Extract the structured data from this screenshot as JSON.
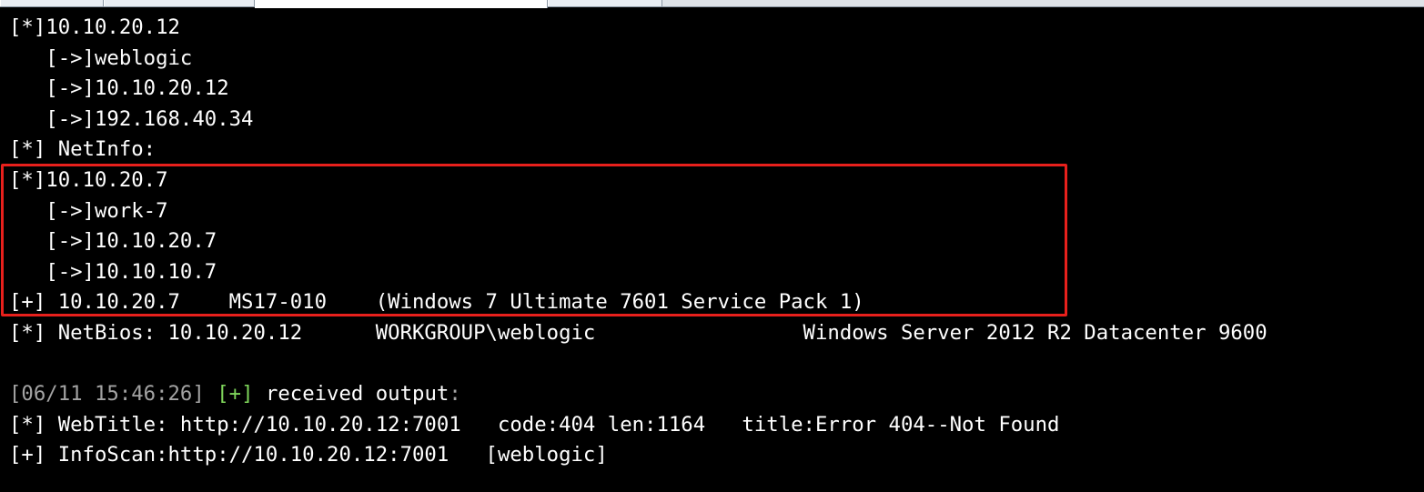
{
  "window": {
    "tabs": [
      {
        "label": "",
        "active": false
      },
      {
        "label": "",
        "active": true
      },
      {
        "label": "",
        "active": false
      }
    ]
  },
  "colors": {
    "background": "#000000",
    "text": "#ffffff",
    "timestamp": "#a3a3a3",
    "success_tag": "#7fd65b",
    "highlight_border": "#e8201c"
  },
  "console": {
    "lines": [
      "[*]10.10.20.12",
      "   [->]weblogic",
      "   [->]10.10.20.12",
      "   [->]192.168.40.34",
      "[*] NetInfo:",
      "[*]10.10.20.7",
      "   [->]work-7",
      "   [->]10.10.20.7",
      "   [->]10.10.10.7",
      "[+] 10.10.20.7    MS17-010    (Windows 7 Ultimate 7601 Service Pack 1)",
      "[*] NetBios: 10.10.20.12      WORKGROUP\\weblogic                 Windows Server 2012 R2 Datacenter 9600",
      "",
      {
        "timestamp": "[06/11 15:46:26]",
        "tag": "[+]",
        "message": " received output",
        "suffix": ":"
      },
      "[*] WebTitle: http://10.10.20.12:7001   code:404 len:1164   title:Error 404--Not Found",
      "[+] InfoScan:http://10.10.20.12:7001   [weblogic]"
    ]
  }
}
